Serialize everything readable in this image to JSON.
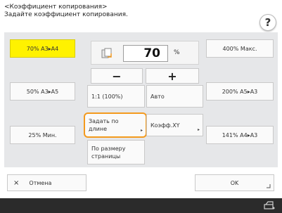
{
  "header": {
    "title": "<Коэффициент копирования>",
    "subtitle": "Задайте коэффициент копирования.",
    "help_label": "?"
  },
  "presets_left": [
    {
      "label": "70% A3▸A4",
      "selected": true
    },
    {
      "label": "50% A3▸A5",
      "selected": false
    },
    {
      "label": "25% Мин.",
      "selected": false
    }
  ],
  "ratio": {
    "value": "70",
    "unit": "%"
  },
  "controls": {
    "minus_label": "−",
    "plus_label": "+",
    "one_to_one_label": "1:1 (100%)",
    "auto_label": "Авто",
    "by_length_label": "Задать по длине",
    "xy_label": "Коэфф.XY",
    "page_size_label": "По размеру страницы"
  },
  "presets_right": [
    {
      "label": "400% Макс."
    },
    {
      "label": "200% A5▸A3"
    },
    {
      "label": "141% A4▸A3"
    }
  ],
  "bottom": {
    "cancel_label": "Отмена",
    "cancel_icon": "×",
    "ok_label": "OK"
  },
  "icons": {
    "ratio_icon": "copy-ratio-icon",
    "footer_icon": "scanner-status-icon"
  },
  "colors": {
    "selected": "#fff200",
    "highlight": "#f39a1e",
    "panel": "#e6e7e9"
  }
}
